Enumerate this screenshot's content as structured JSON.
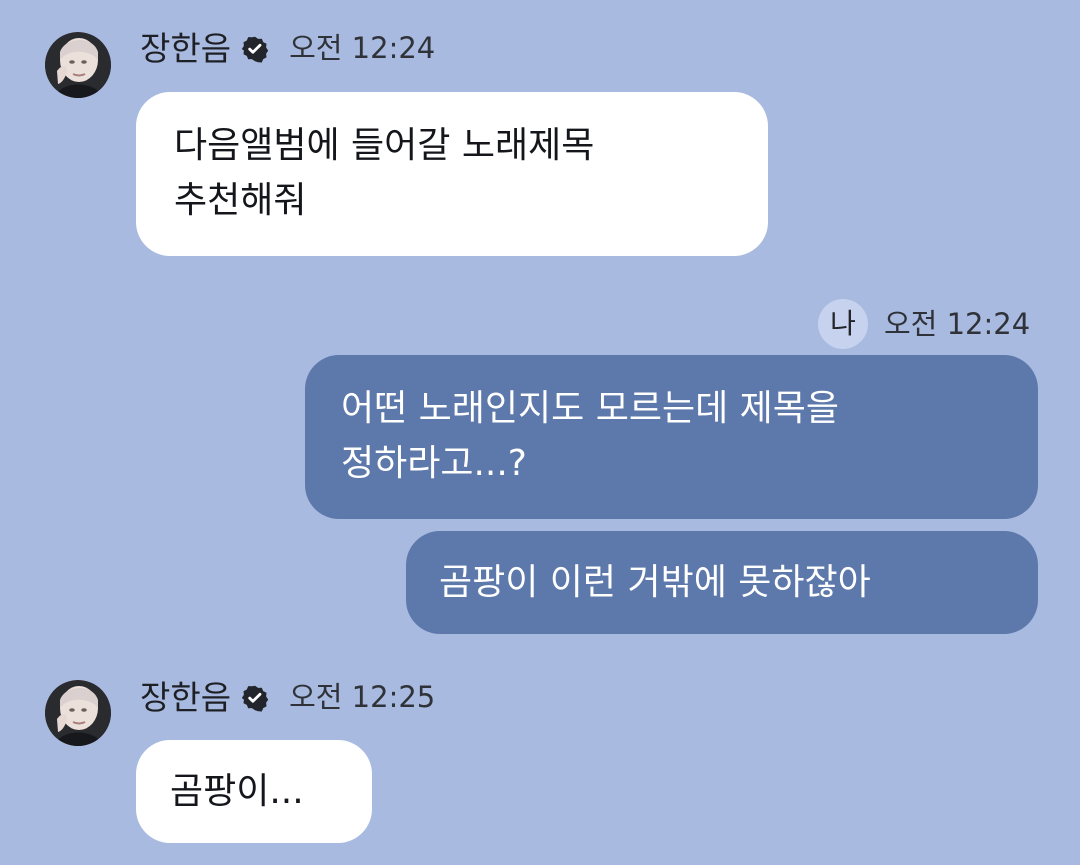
{
  "messages": [
    {
      "sender": "장한음",
      "time": "오전 12:24",
      "text": "다음앨범에 들어갈 노래제목\n추천해줘"
    },
    {
      "sender_badge": "나",
      "time": "오전 12:24",
      "texts": [
        "어떤 노래인지도 모르는데 제목을\n정하라고...?",
        "곰팡이 이런 거밖에 못하잖아"
      ]
    },
    {
      "sender": "장한음",
      "time": "오전 12:25",
      "text": "곰팡이..."
    }
  ],
  "colors": {
    "background": "#a8badf",
    "incoming_bubble": "#ffffff",
    "outgoing_bubble": "#5d78aa",
    "text_dark": "#14161b",
    "text_light": "#ffffff"
  },
  "icons": {
    "avatar": "profile-avatar",
    "verified": "verified-icon"
  }
}
